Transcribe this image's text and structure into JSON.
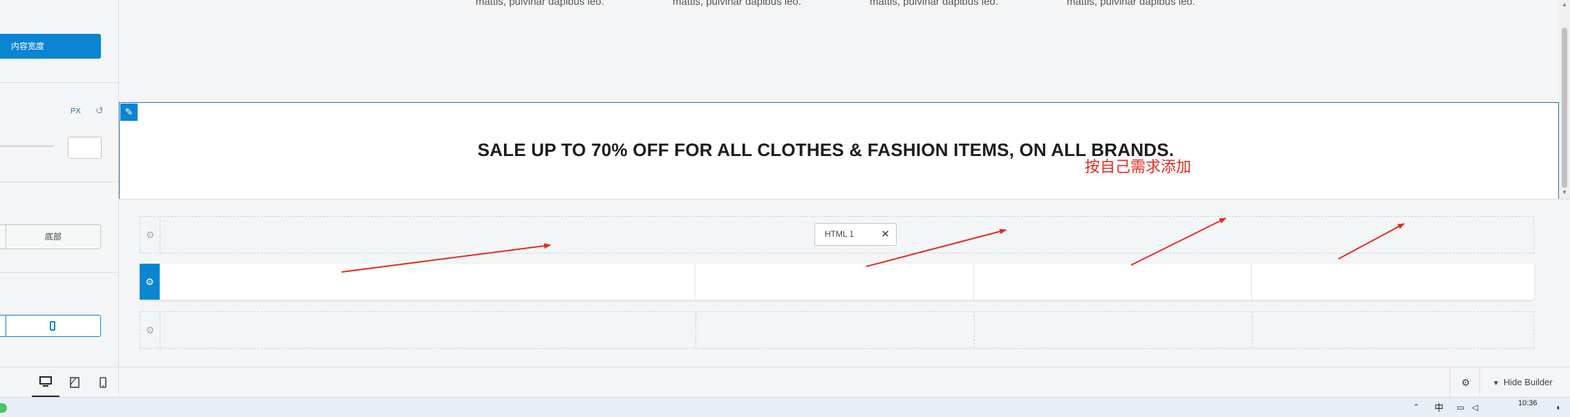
{
  "sidebar": {
    "content_width_button": "内容宽度",
    "unit_label": "PX",
    "reset_icon": "undo-icon",
    "position_segment_label": "底部",
    "device_icon": "mobile-device-icon"
  },
  "preview": {
    "column_texts": [
      "mattis, pulvinar dapibus leo.",
      "mattis, pulvinar dapibus leo.",
      "mattis, pulvinar dapibus leo.",
      "mattis, pulvinar dapibus leo."
    ],
    "edit_icon": "pencil-icon",
    "sale_heading": "SALE UP TO 70% OFF FOR ALL CLOTHES & FASHION ITEMS, ON ALL BRANDS.",
    "annotation_note": "按自己需求添加"
  },
  "builder": {
    "rows": [
      {
        "name": "top-row",
        "gear_icon": "gear-icon",
        "items": [
          {
            "label": "HTML 1",
            "close_icon": "close-icon"
          }
        ]
      },
      {
        "name": "main-row",
        "gear_icon": "gear-icon",
        "columns": 4
      },
      {
        "name": "bottom-row",
        "gear_icon": "gear-icon",
        "columns": 4
      }
    ]
  },
  "footer": {
    "devices": [
      "desktop-icon",
      "tablet-icon",
      "mobile-icon"
    ],
    "active_device": "desktop-icon",
    "settings_icon": "gear-icon",
    "hide_builder_label": "Hide Builder",
    "chevron_icon": "chevron-down-icon"
  },
  "taskbar": {
    "ime_label": "中",
    "clock_time": "10:36"
  },
  "colors": {
    "accent": "#0a85d1",
    "annotation_red": "#e22b20",
    "banner_border": "#2271b1"
  }
}
